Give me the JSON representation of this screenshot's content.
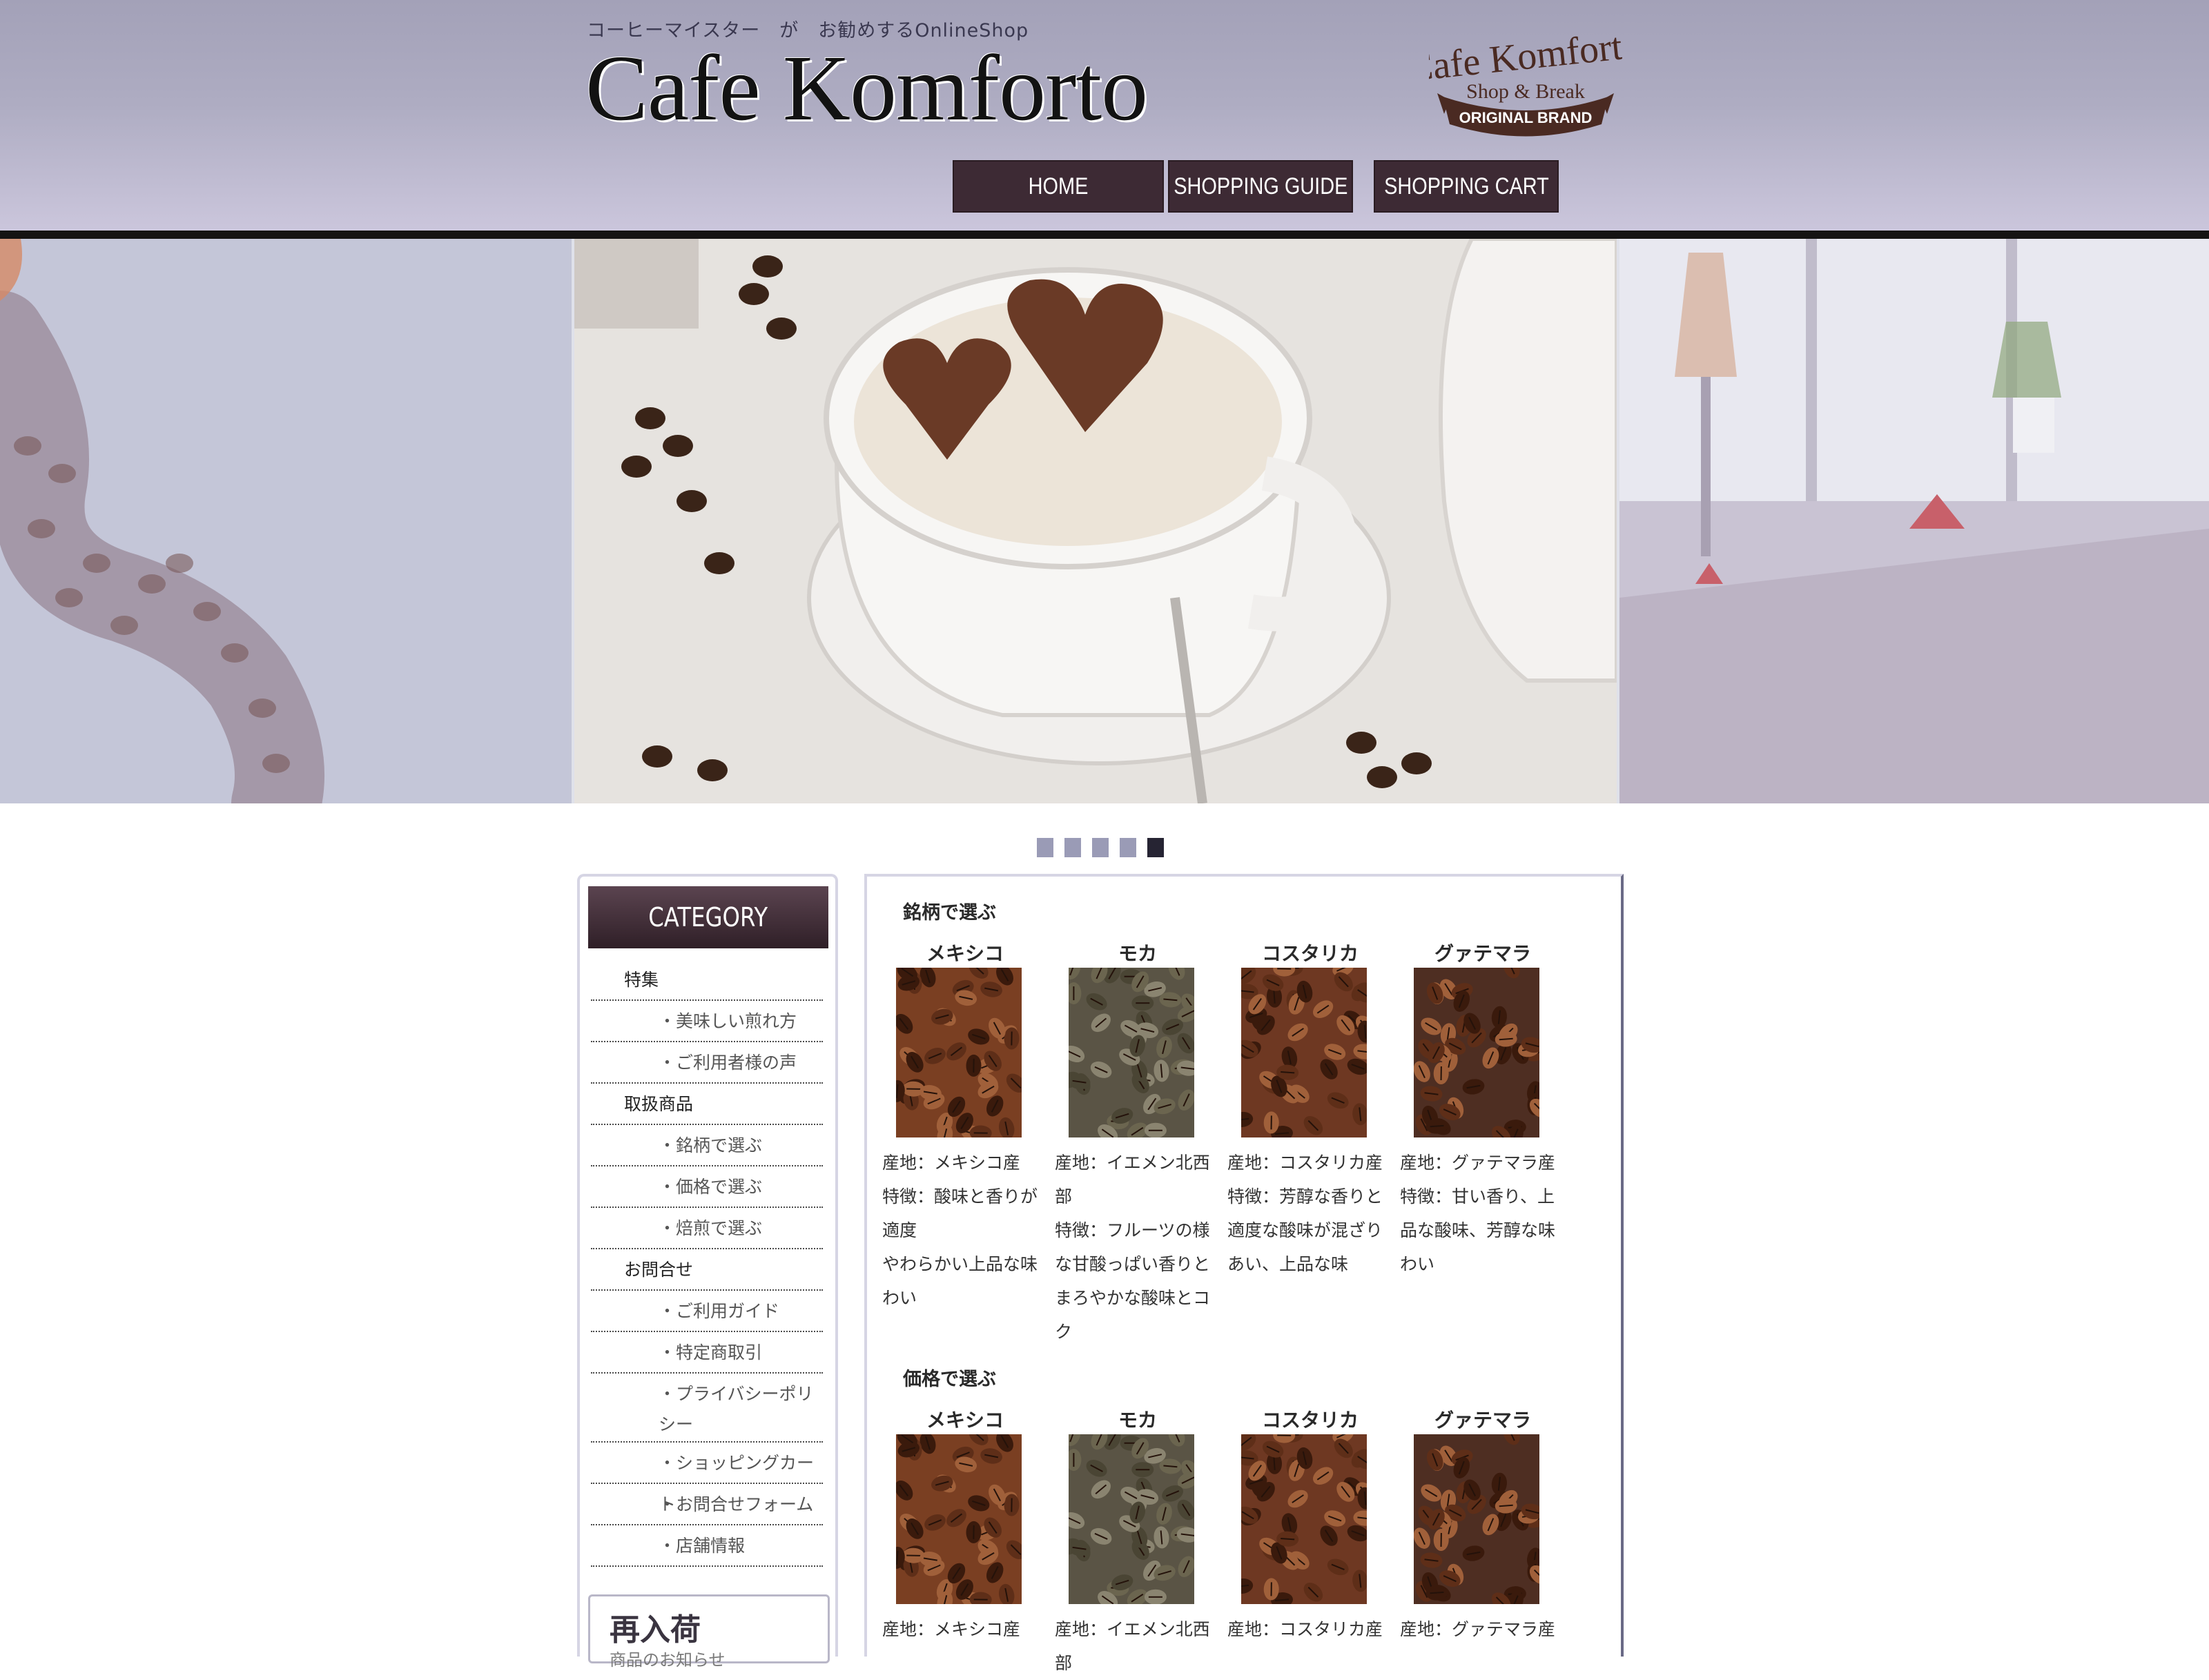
{
  "header": {
    "tagline": "コーヒーマイスター　が　お勧めするOnlineShop",
    "title": "Cafe Komforto",
    "logo": {
      "line1": "Cafe Komforto",
      "line2": "Shop & Break",
      "line3": "ORIGINAL BRAND"
    }
  },
  "nav": {
    "home": "HOME",
    "guide": "SHOPPING GUIDE",
    "cart": "SHOPPING CART"
  },
  "slider": {
    "slide_count": 5,
    "active_index": 4
  },
  "sidebar": {
    "title": "CATEGORY",
    "items": [
      {
        "label": "特集",
        "type": "heading"
      },
      {
        "label": "・美味しい煎れ方",
        "type": "sub"
      },
      {
        "label": "・ご利用者様の声",
        "type": "sub"
      },
      {
        "label": "取扱商品",
        "type": "heading"
      },
      {
        "label": "・銘柄で選ぶ",
        "type": "sub"
      },
      {
        "label": "・価格で選ぶ",
        "type": "sub"
      },
      {
        "label": "・焙煎で選ぶ",
        "type": "sub"
      },
      {
        "label": "お問合せ",
        "type": "heading"
      },
      {
        "label": "・ご利用ガイド",
        "type": "sub"
      },
      {
        "label": "・特定商取引",
        "type": "sub"
      },
      {
        "label": "・プライバシーポリシー",
        "type": "sub"
      },
      {
        "label": "・ショッピングカート",
        "type": "sub"
      },
      {
        "label": "・お問合せフォーム",
        "type": "sub"
      },
      {
        "label": "・店舗情報",
        "type": "sub"
      }
    ],
    "restock_title": "再入荷",
    "restock_sub": "商品のお知らせ"
  },
  "sections": [
    {
      "title": "銘柄で選ぶ",
      "products": [
        {
          "name": "メキシコ",
          "origin": "産地：メキシコ産",
          "desc": "特徴：酸味と香りが適度\nやわらかい上品な味わい",
          "tone": "#7a3f22"
        },
        {
          "name": "モカ",
          "origin": "産地：イエメン北西部",
          "desc": "特徴：フルーツの様な甘酸っぱい香りとまろやかな酸味とコク",
          "tone": "#5a5445"
        },
        {
          "name": "コスタリカ",
          "origin": "産地：コスタリカ産",
          "desc": "特徴：芳醇な香りと適度な酸味が混ざりあい、上品な味",
          "tone": "#6e3822"
        },
        {
          "name": "グァテマラ",
          "origin": "産地：グァテマラ産",
          "desc": "特徴：甘い香り、上品な酸味、芳醇な味わい",
          "tone": "#4e2e22"
        }
      ]
    },
    {
      "title": "価格で選ぶ",
      "products": [
        {
          "name": "メキシコ",
          "origin": "産地：メキシコ産",
          "desc": "",
          "tone": "#7a3f22"
        },
        {
          "name": "モカ",
          "origin": "産地：イエメン北西部",
          "desc": "",
          "tone": "#5a5445"
        },
        {
          "name": "コスタリカ",
          "origin": "産地：コスタリカ産",
          "desc": "",
          "tone": "#6e3822"
        },
        {
          "name": "グァテマラ",
          "origin": "産地：グァテマラ産",
          "desc": "",
          "tone": "#4e2e22"
        }
      ]
    }
  ],
  "colors": {
    "header_top": "#a3a1b8",
    "nav_bg": "#3d2a34",
    "accent_dark": "#262433",
    "dot_inactive": "#9a9bb6"
  }
}
